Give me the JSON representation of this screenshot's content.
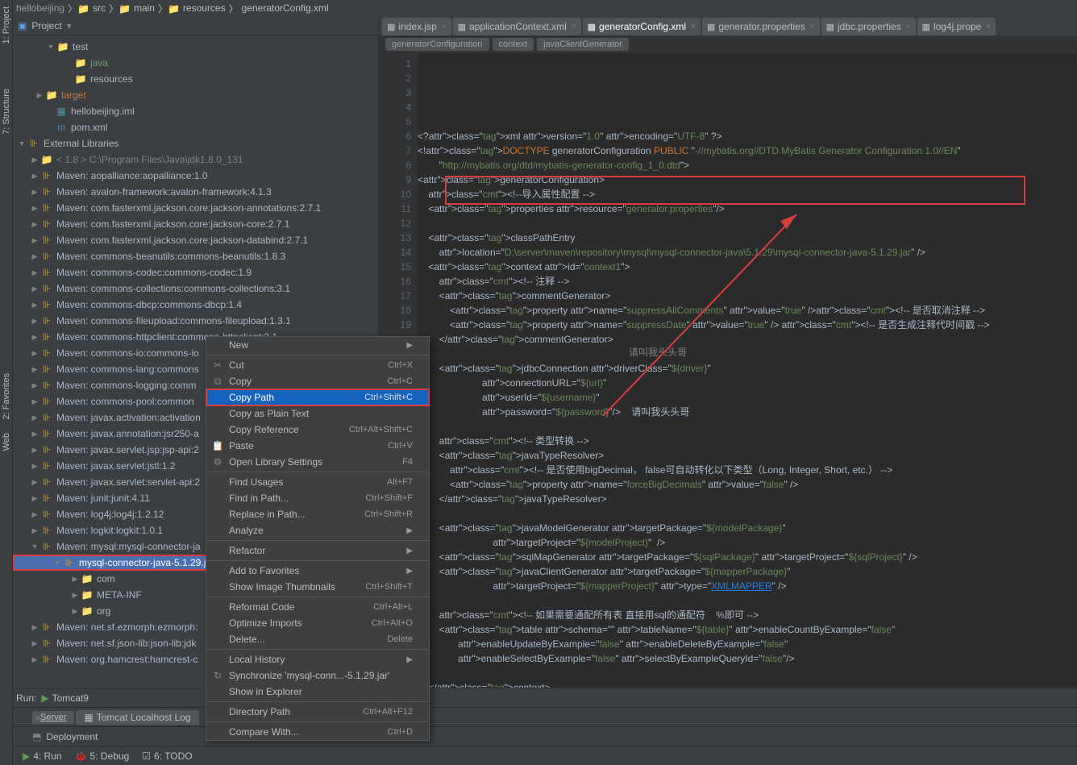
{
  "breadcrumb": {
    "project": "hellobeijing",
    "parts": [
      "src",
      "main",
      "resources",
      "generatorConfig.xml"
    ]
  },
  "left_tabs": [
    "1: Project",
    "7: Structure",
    "2: Favorites",
    "Web"
  ],
  "panel": {
    "title": "Project"
  },
  "tree": {
    "test": "test",
    "java": "java",
    "resources": "resources",
    "target": "target",
    "iml": "hellobeijing.iml",
    "pom": "pom.xml",
    "ext_libs": "External Libraries",
    "jdk": "< 1.8 >  C:\\Program Files\\Java\\jdk1.8.0_131",
    "libs": [
      "Maven: aopalliance:aopalliance:1.0",
      "Maven: avalon-framework:avalon-framework:4.1.3",
      "Maven: com.fasterxml.jackson.core:jackson-annotations:2.7.1",
      "Maven: com.fasterxml.jackson.core:jackson-core:2.7.1",
      "Maven: com.fasterxml.jackson.core:jackson-databind:2.7.1",
      "Maven: commons-beanutils:commons-beanutils:1.8.3",
      "Maven: commons-codec:commons-codec:1.9",
      "Maven: commons-collections:commons-collections:3.1",
      "Maven: commons-dbcp:commons-dbcp:1.4",
      "Maven: commons-fileupload:commons-fileupload:1.3.1",
      "Maven: commons-httpclient:commons-httpclient:3.1",
      "Maven: commons-io:commons-io",
      "Maven: commons-lang:commons",
      "Maven: commons-logging:comm",
      "Maven: commons-pool:common",
      "Maven: javax.activation:activation",
      "Maven: javax.annotation:jsr250-a",
      "Maven: javax.servlet.jsp:jsp-api:2",
      "Maven: javax.servlet:jstl:1.2",
      "Maven: javax.servlet:servlet-api:2",
      "Maven: junit:junit:4.11",
      "Maven: log4j:log4j:1.2.12",
      "Maven: logkit:logkit:1.0.1",
      "Maven: mysql:mysql-connector-ja"
    ],
    "selected_jar": "mysql-connector-java-5.1.29.j",
    "jar_children": [
      "com",
      "META-INF",
      "org"
    ],
    "libs_after": [
      "Maven: net.sf.ezmorph:ezmorph:",
      "Maven: net.sf.json-lib:json-lib:jdk",
      "Maven: org.hamcrest:hamcrest-c"
    ]
  },
  "editor_tabs": [
    {
      "label": "index.jsp",
      "active": false
    },
    {
      "label": "applicationContext.xml",
      "active": false
    },
    {
      "label": "generatorConfig.xml",
      "active": true
    },
    {
      "label": "generator.properties",
      "active": false
    },
    {
      "label": "jdbc.properties",
      "active": false
    },
    {
      "label": "log4j.prope",
      "active": false
    }
  ],
  "editor_breadcrumb": [
    "generatorConfiguration",
    "context",
    "javaClientGenerator"
  ],
  "chart_data": {
    "type": "code",
    "language": "xml",
    "lines": [
      {
        "n": 1,
        "t": "<?xml version=\"1.0\" encoding=\"UTF-8\" ?>"
      },
      {
        "n": 2,
        "t": "<!DOCTYPE generatorConfiguration PUBLIC \"-//mybatis.org//DTD MyBatis Generator Configuration 1.0//EN\""
      },
      {
        "n": 3,
        "t": "        \"http://mybatis.org/dtd/mybatis-generator-config_1_0.dtd\">"
      },
      {
        "n": 4,
        "t": "<generatorConfiguration>"
      },
      {
        "n": 5,
        "t": "    <!--导入属性配置 -->"
      },
      {
        "n": 6,
        "t": "    <properties resource=\"generator.properties\"/>"
      },
      {
        "n": 7,
        "t": ""
      },
      {
        "n": 8,
        "t": "    <classPathEntry"
      },
      {
        "n": 9,
        "t": "        location=\"D:\\server\\maven\\repository\\mysql\\mysql-connector-java\\5.1.29\\mysql-connector-java-5.1.29.jar\" />"
      },
      {
        "n": 10,
        "t": "    <context id=\"context1\">"
      },
      {
        "n": 11,
        "t": "        <!-- 注释 -->"
      },
      {
        "n": 12,
        "t": "        <commentGenerator>"
      },
      {
        "n": 13,
        "t": "            <property name=\"suppressAllComments\" value=\"true\" /><!-- 是否取消注释 -->"
      },
      {
        "n": 14,
        "t": "            <property name=\"suppressDate\" value=\"true\" /> <!-- 是否生成注释代时间戳 -->"
      },
      {
        "n": 15,
        "t": "        </commentGenerator>"
      },
      {
        "n": 16,
        "t": ""
      },
      {
        "n": 17,
        "t": "        <jdbcConnection driverClass=\"${driver}\""
      },
      {
        "n": 18,
        "t": "                        connectionURL=\"${url}\""
      },
      {
        "n": 19,
        "t": "                        userId=\"${username}\""
      },
      {
        "n": "",
        "t": "                        password=\"${password}\"/>    请叫我头头哥"
      },
      {
        "n": "",
        "t": ""
      },
      {
        "n": "",
        "t": "        <!-- 类型转换 -->"
      },
      {
        "n": "",
        "t": "        <javaTypeResolver>"
      },
      {
        "n": "",
        "t": "            <!-- 是否使用bigDecimal， false可自动转化以下类型（Long, Integer, Short, etc.） -->"
      },
      {
        "n": "",
        "t": "            <property name=\"forceBigDecimals\" value=\"false\" />"
      },
      {
        "n": "",
        "t": "        </javaTypeResolver>"
      },
      {
        "n": "",
        "t": ""
      },
      {
        "n": "",
        "t": "        <javaModelGenerator targetPackage=\"${modelPackage}\""
      },
      {
        "n": "",
        "t": "                            targetProject=\"${modelProject}\"  />"
      },
      {
        "n": "",
        "t": "        <sqlMapGenerator targetPackage=\"${sqlPackage}\" targetProject=\"${sqlProject}\" />"
      },
      {
        "n": "",
        "t": "        <javaClientGenerator targetPackage=\"${mapperPackage}\""
      },
      {
        "n": "",
        "t": "                            targetProject=\"${mapperProject}\" type=\"XMLMAPPER\" />"
      },
      {
        "n": "",
        "t": ""
      },
      {
        "n": "",
        "t": "        <!-- 如果需要通配所有表 直接用sql的通配符    %即可 -->"
      },
      {
        "n": "",
        "t": "        <table schema=\"\" tableName=\"${table}\" enableCountByExample=\"false\""
      },
      {
        "n": "",
        "t": "               enableUpdateByExample=\"false\" enableDeleteByExample=\"false\""
      },
      {
        "n": "",
        "t": "               enableSelectByExample=\"false\" selectByExampleQueryId=\"false\"/>"
      },
      {
        "n": "",
        "t": ""
      },
      {
        "n": "",
        "t": "    </context>"
      },
      {
        "n": "",
        "t": "</generatorConfiguration>"
      }
    ]
  },
  "watermark": "请叫我头头哥",
  "context_menu": [
    {
      "label": "New",
      "sub": true
    },
    {
      "sep": true
    },
    {
      "label": "Cut",
      "shortcut": "Ctrl+X",
      "icon": "✂"
    },
    {
      "label": "Copy",
      "shortcut": "Ctrl+C",
      "icon": "⧉"
    },
    {
      "label": "Copy Path",
      "shortcut": "Ctrl+Shift+C",
      "selected": true
    },
    {
      "label": "Copy as Plain Text"
    },
    {
      "label": "Copy Reference",
      "shortcut": "Ctrl+Alt+Shift+C"
    },
    {
      "label": "Paste",
      "shortcut": "Ctrl+V",
      "icon": "📋"
    },
    {
      "label": "Open Library Settings",
      "shortcut": "F4",
      "icon": "⚙"
    },
    {
      "sep": true
    },
    {
      "label": "Find Usages",
      "shortcut": "Alt+F7"
    },
    {
      "label": "Find in Path...",
      "shortcut": "Ctrl+Shift+F"
    },
    {
      "label": "Replace in Path...",
      "shortcut": "Ctrl+Shift+R"
    },
    {
      "label": "Analyze",
      "sub": true
    },
    {
      "sep": true
    },
    {
      "label": "Refactor",
      "sub": true
    },
    {
      "sep": true
    },
    {
      "label": "Add to Favorites",
      "sub": true
    },
    {
      "label": "Show Image Thumbnails",
      "shortcut": "Ctrl+Shift+T"
    },
    {
      "sep": true
    },
    {
      "label": "Reformat Code",
      "shortcut": "Ctrl+Alt+L"
    },
    {
      "label": "Optimize Imports",
      "shortcut": "Ctrl+Alt+O"
    },
    {
      "label": "Delete...",
      "shortcut": "Delete"
    },
    {
      "sep": true
    },
    {
      "label": "Local History",
      "sub": true
    },
    {
      "label": "Synchronize 'mysql-conn...-5.1.29.jar'",
      "icon": "↻"
    },
    {
      "label": "Show in Explorer"
    },
    {
      "sep": true
    },
    {
      "label": "Directory Path",
      "shortcut": "Ctrl+Alt+F12"
    },
    {
      "sep": true
    },
    {
      "label": "Compare With...",
      "shortcut": "Ctrl+D"
    }
  ],
  "run": {
    "label": "Run:",
    "config": "Tomcat9"
  },
  "server_tabs": [
    "Server",
    "Tomcat Localhost Log"
  ],
  "deploy": "Deployment",
  "bottom_tool_tabs": [
    "4: Run",
    "5: Debug",
    "6: TODO"
  ]
}
